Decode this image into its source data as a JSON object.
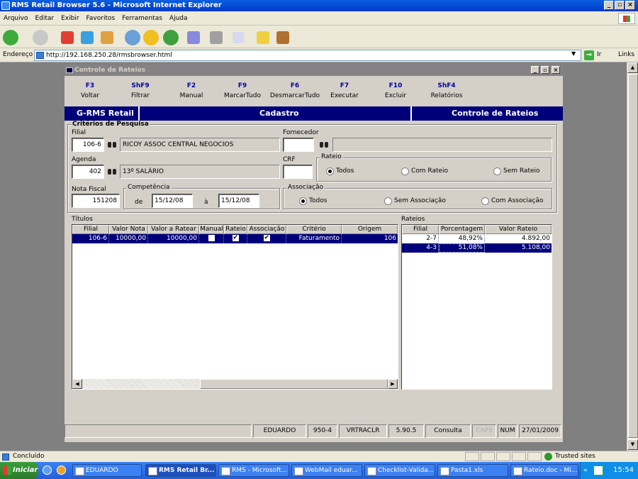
{
  "window": {
    "title": "RMS Retail Browser 5.6 - Microsoft Internet Explorer"
  },
  "menu": [
    "Arquivo",
    "Editar",
    "Exibir",
    "Favoritos",
    "Ferramentas",
    "Ajuda"
  ],
  "address": {
    "label": "Endereço",
    "url": "http://192.168.250.28/rmsbrowser.html",
    "go": "Ir",
    "links": "Links"
  },
  "app": {
    "title": "Controle de Rateios",
    "fkeys": [
      {
        "key": "F3",
        "label": "Voltar"
      },
      {
        "key": "ShF9",
        "label": "Filtrar"
      },
      {
        "key": "F2",
        "label": "Manual"
      },
      {
        "key": "F9",
        "label": "MarcarTudo"
      },
      {
        "key": "F6",
        "label": "DesmarcarTudo"
      },
      {
        "key": "F7",
        "label": "Executar"
      },
      {
        "key": "F10",
        "label": "Excluir"
      },
      {
        "key": "ShF4",
        "label": "Relatórios"
      }
    ],
    "banner": {
      "left": "G-RMS Retail",
      "center": "Cadastro",
      "right": "Controle de Rateios"
    }
  },
  "criteria": {
    "title": "Critérios de Pesquisa",
    "filial": {
      "label": "Filial",
      "code": "106-6",
      "name": "RICOY ASSOC CENTRAL NEGOCIOS"
    },
    "fornecedor": {
      "label": "Fornecedor",
      "code": "",
      "name": ""
    },
    "agenda": {
      "label": "Agenda",
      "code": "402",
      "name": "13º SALÁRIO"
    },
    "crf": {
      "label": "CRF",
      "value": ""
    },
    "rateio": {
      "label": "Rateio",
      "options": [
        "Todos",
        "Com Rateio",
        "Sem Rateio"
      ],
      "selected": "Todos"
    },
    "nota": {
      "label": "Nota Fiscal",
      "value": "151208"
    },
    "competencia": {
      "label": "Competência",
      "de_label": "de",
      "de": "15/12/08",
      "a_label": "à",
      "a": "15/12/08"
    },
    "associacao": {
      "label": "Associação",
      "options": [
        "Todos",
        "Sem Associação",
        "Com Associação"
      ],
      "selected": "Todos"
    }
  },
  "titulos": {
    "label": "Títulos",
    "columns": [
      "Filial",
      "Valor Nota",
      "Valor a Ratear",
      "Manual",
      "Rateio",
      "Associação",
      "Critério",
      "Origem"
    ],
    "rows": [
      {
        "filial": "106-6",
        "valor_nota": "10000,00",
        "valor_ratear": "10000,00",
        "manual": false,
        "rateio": true,
        "associacao": true,
        "criterio": "Faturamento",
        "origem": "106"
      }
    ]
  },
  "rateios": {
    "label": "Rateios",
    "columns": [
      "Filial",
      "Porcentagem",
      "Valor Rateio"
    ],
    "rows": [
      {
        "filial": "2-7",
        "porcentagem": "48,92%",
        "valor": "4.892,00"
      },
      {
        "filial": "4-3",
        "porcentagem": "51,08%",
        "valor": "5.108,00"
      }
    ],
    "selected_index": 1
  },
  "statusbar": [
    "EDUARDO",
    "950-4",
    "VRTRACLR",
    "5.90.5",
    "Consulta",
    "CAPS",
    "NUM",
    "27/01/2009"
  ],
  "iestatus": {
    "left": "Concluído",
    "right": "Trusted sites"
  },
  "taskbar": {
    "start": "Iniciar",
    "items": [
      "EDUARDO",
      "RMS Retail Br...",
      "RMS - Microsoft...",
      "WebMail eduar...",
      "Checklist-Valida...",
      "Pasta1.xls",
      "Rateio.doc - Mi..."
    ],
    "clock": "15:54"
  }
}
